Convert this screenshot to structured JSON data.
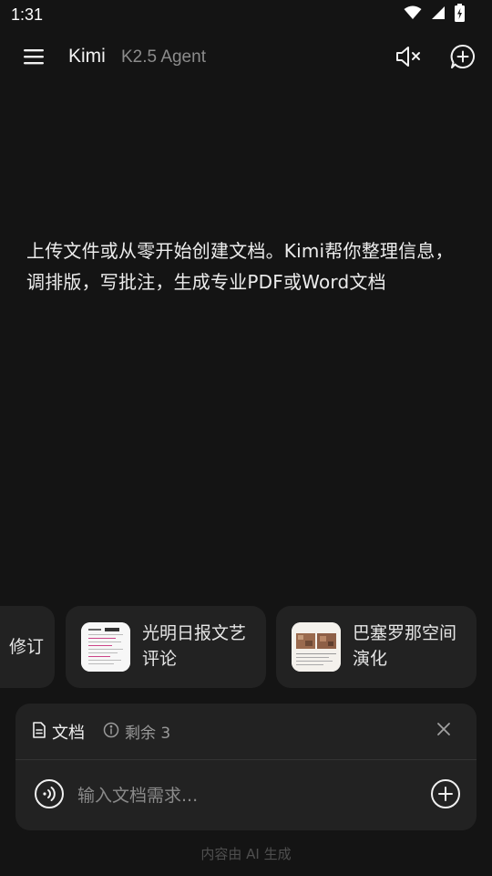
{
  "status_bar": {
    "time": "1:31",
    "icons": [
      "wifi-icon",
      "cellular-signal-icon",
      "battery-charging-icon"
    ]
  },
  "header": {
    "menu_icon": "hamburger-menu-icon",
    "app_title": "Kimi",
    "model_name": "K2.5 Agent",
    "mute_icon": "speaker-muted-icon",
    "new_chat_icon": "new-chat-icon"
  },
  "intro": {
    "text": "上传文件或从零开始创建文档。Kimi帮你整理信息，调排版，写批注，生成专业PDF或Word文档"
  },
  "suggestions": [
    {
      "label": "修订"
    },
    {
      "label": "光明日报文艺评论",
      "thumb": "document-preview-thumbnail"
    },
    {
      "label": "巴塞罗那空间演化",
      "thumb": "city-map-thumbnail"
    }
  ],
  "input_panel": {
    "mode_label": "文档",
    "mode_icon": "document-icon",
    "quota_icon": "info-icon",
    "quota_label": "剩余 3",
    "close_icon": "close-icon",
    "voice_icon": "voice-input-icon",
    "placeholder": "输入文档需求...",
    "value": "",
    "add_icon": "plus-circle-icon"
  },
  "footer": {
    "note": "内容由 AI 生成"
  },
  "colors": {
    "background": "#141414",
    "card": "#222222",
    "text_primary": "#ececec",
    "text_secondary": "#8c8c8c"
  }
}
